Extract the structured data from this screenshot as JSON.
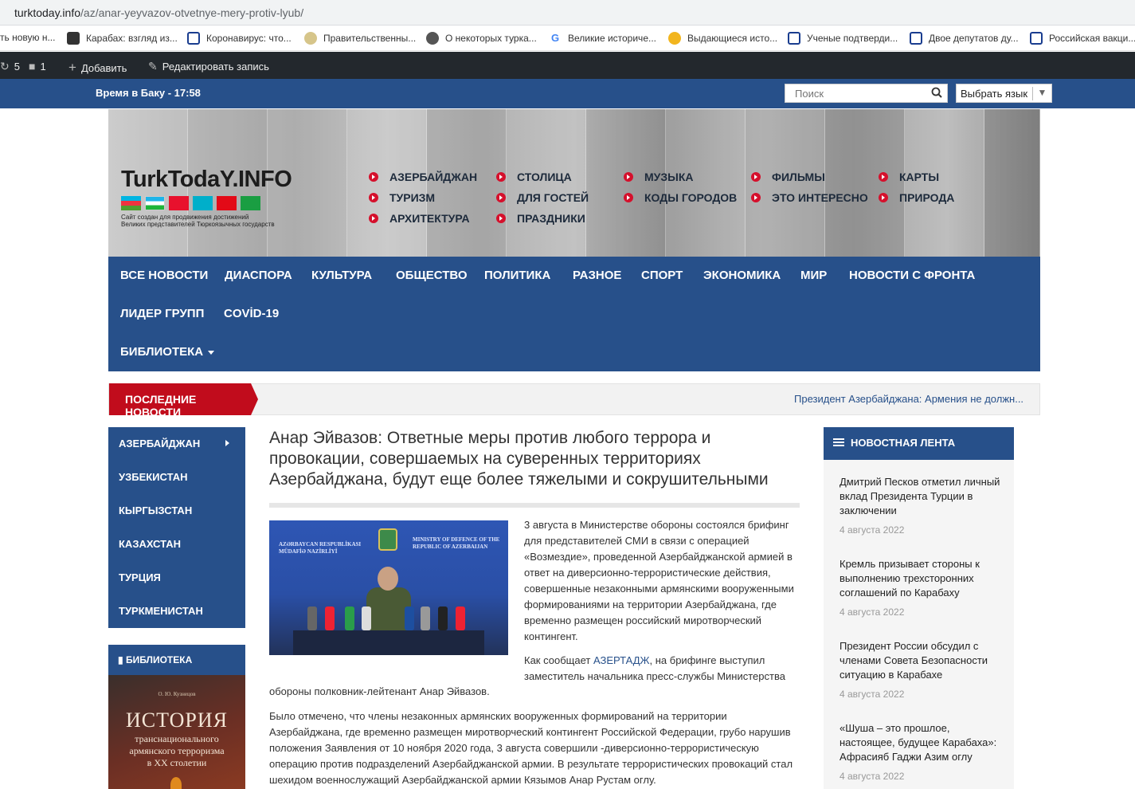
{
  "browser": {
    "url_host": "turktoday.info",
    "url_path": "/az/anar-yeyvazov-otvetnye-mery-protiv-lyub/"
  },
  "bookmarks": [
    {
      "label": "ть новую н...",
      "icon": "blank-icon"
    },
    {
      "label": "Карабах: взгляд из...",
      "icon": "plus-square-icon"
    },
    {
      "label": "Коронавирус: что...",
      "icon": "window-icon"
    },
    {
      "label": "Правительственны...",
      "icon": "emblem-icon"
    },
    {
      "label": "О некоторых турка...",
      "icon": "globe-icon"
    },
    {
      "label": "Великие историче...",
      "icon": "google-icon"
    },
    {
      "label": "Выдающиеся исто...",
      "icon": "sun-icon"
    },
    {
      "label": "Ученые подтверди...",
      "icon": "face-icon"
    },
    {
      "label": "Двое депутатов ду...",
      "icon": "face-icon"
    },
    {
      "label": "Российская вакци...",
      "icon": "face-icon"
    }
  ],
  "adminbar": {
    "updates": "5",
    "comments": "1",
    "add": "Добавить",
    "edit": "Редактировать запись"
  },
  "topstrip": {
    "time": "Время в Баку - 17:58",
    "search_placeholder": "Поиск",
    "language": "Выбрать язык"
  },
  "header": {
    "logo": "TurkTodaY.INFO",
    "tagline_1": "Сайт создан для продвижения достижений",
    "tagline_2": "Великих представителей Тюркоязычных государств",
    "menu": [
      "АЗЕРБАЙДЖАН",
      "ТУРИЗМ",
      "АРХИТЕКТУРА",
      "СТОЛИЦА",
      "ДЛЯ ГОСТЕЙ",
      "ПРАЗДНИКИ",
      "МУЗЫКА",
      "КОДЫ ГОРОДОВ",
      "ФИЛЬМЫ",
      "ЭТО ИНТЕРЕСНО",
      "КАРТЫ",
      "ПРИРОДА"
    ]
  },
  "mainnav": [
    "ВСЕ НОВОСТИ",
    "ДИАСПОРА",
    "КУЛЬТУРА",
    "ОБЩЕСТВО",
    "ПОЛИТИКА",
    "РАЗНОЕ",
    "СПОРТ",
    "ЭКОНОМИКА",
    "МИР",
    "НОВОСТИ С ФРОНТА",
    "ЛИДЕР ГРУПП",
    "COVİD-19",
    "БИБЛИОТЕКА"
  ],
  "ticker": {
    "label": "ПОСЛЕДНИЕ НОВОСТИ",
    "text": "Президент Азербайджана: Армения не должн..."
  },
  "left_sidebar": {
    "countries": [
      "АЗЕРБАЙДЖАН",
      "УЗБЕКИСТАН",
      "КЫРГЫЗСТАН",
      "КАЗАХСТАН",
      "ТУРЦИЯ",
      "ТУРКМЕНИСТАН"
    ],
    "library_title": "БИБЛИОТЕКА",
    "book_author": "О. Ю. Кузнецов",
    "book_title": "ИСТОРИЯ",
    "book_sub_1": "транснационального",
    "book_sub_2": "армянского терроризма",
    "book_sub_3": "в XX столетии"
  },
  "article": {
    "title": "Анар Эйвазов: Ответные меры против любого террора и провокации, совершаемых на суверенных территориях Азербайджана, будут еще более тяжелыми и сокрушительными",
    "photo_banner_left_1": "AZƏRBAYCAN RESPUBLİKASI",
    "photo_banner_left_2": "MÜDAFİƏ NAZİRLİYİ",
    "photo_banner_right_1": "MINISTRY OF DEFENCE OF THE",
    "photo_banner_right_2": "REPUBLIC OF AZERBAIJAN",
    "p1": "3 августа в Министерстве обороны состоялся брифинг для представителей СМИ в связи с операцией «Возмездие», проведенной Азербайджанской армией в ответ на диверсионно-террористические действия, совершенные незаконными армянскими вооруженными формированиями на территории Азербайджана, где временно размещен российский миротворческий контингент.",
    "p2_pre": "Как сообщает ",
    "p2_link": "АЗЕРТАДЖ",
    "p2_post": ", на брифинге выступил заместитель начальника пресс-службы Министерства",
    "p2_tail": "обороны полковник-лейтенант Анар Эйвазов.",
    "p3": "Было отмечено, что члены незаконных армянских вооруженных формирований на территории Азербайджана, где временно размещен миротворческий контингент Российской Федерации, грубо нарушив положения Заявления от 10 ноября 2020 года, 3 августа совершили -диверсионно-террористическую операцию против подразделений Азербайджанской армии. В результате террористических провокаций стал шехидом военнослужащий Азербайджанской армии Кязымов Анар Рустам оглу."
  },
  "right_sidebar": {
    "title": "НОВОСТНАЯ ЛЕНТА",
    "items": [
      {
        "text": "Дмитрий Песков отметил личный вклад Президента Турции в заключении",
        "date": "4 августа 2022"
      },
      {
        "text": "Кремль призывает стороны к выполнению трехсторонних соглашений по Карабаху",
        "date": "4 августа 2022"
      },
      {
        "text": "Президент России обсудил с членами Совета Безопасности ситуацию в Карабахе",
        "date": "4 августа 2022"
      },
      {
        "text": "«Шуша – это прошлое, настоящее, будущее Карабаха»: Афрасияб Гаджи Азим оглу",
        "date": "4 августа 2022"
      }
    ]
  },
  "colors": {
    "brand_blue": "#27508a",
    "ticker_red": "#c10c1c",
    "menu_dot_red": "#d5102c",
    "admin_bar": "#23282d"
  }
}
